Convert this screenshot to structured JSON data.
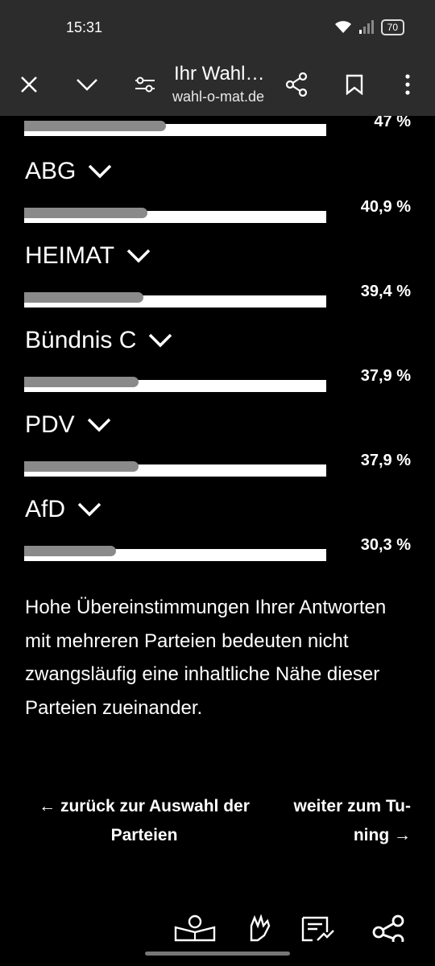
{
  "status": {
    "time": "15:31",
    "battery": "70"
  },
  "browser": {
    "title": "Ihr Wahl…",
    "url": "wahl-o-mat.de"
  },
  "parties": [
    {
      "name": "",
      "percent": "47 %",
      "match": 0.47
    },
    {
      "name": "ABG",
      "percent": "40,9 %",
      "match": 0.409
    },
    {
      "name": "HEIMAT",
      "percent": "39,4 %",
      "match": 0.394
    },
    {
      "name": "Bündnis C",
      "percent": "37,9 %",
      "match": 0.379
    },
    {
      "name": "PDV",
      "percent": "37,9 %",
      "match": 0.379
    },
    {
      "name": "AfD",
      "percent": "30,3 %",
      "match": 0.303
    }
  ],
  "note": "Hohe Übereinstimmungen Ihrer Antworten mit mehreren Parteien bedeuten nicht zwangsläufig eine inhaltliche Nähe dieser Parteien zueinander.",
  "nav": {
    "back_label": "← zurück zur Auswahl der Parteien",
    "next_label": "weiter zum Tu-ning →"
  },
  "bottom_icons": [
    "reading-person-icon",
    "sign-language-icon",
    "easy-language-icon",
    "share-icon"
  ],
  "colors": {
    "background": "#000000",
    "bar_track": "#ffffff",
    "bar_fill": "#8a8a8a",
    "toolbar": "#2c2c2c"
  }
}
